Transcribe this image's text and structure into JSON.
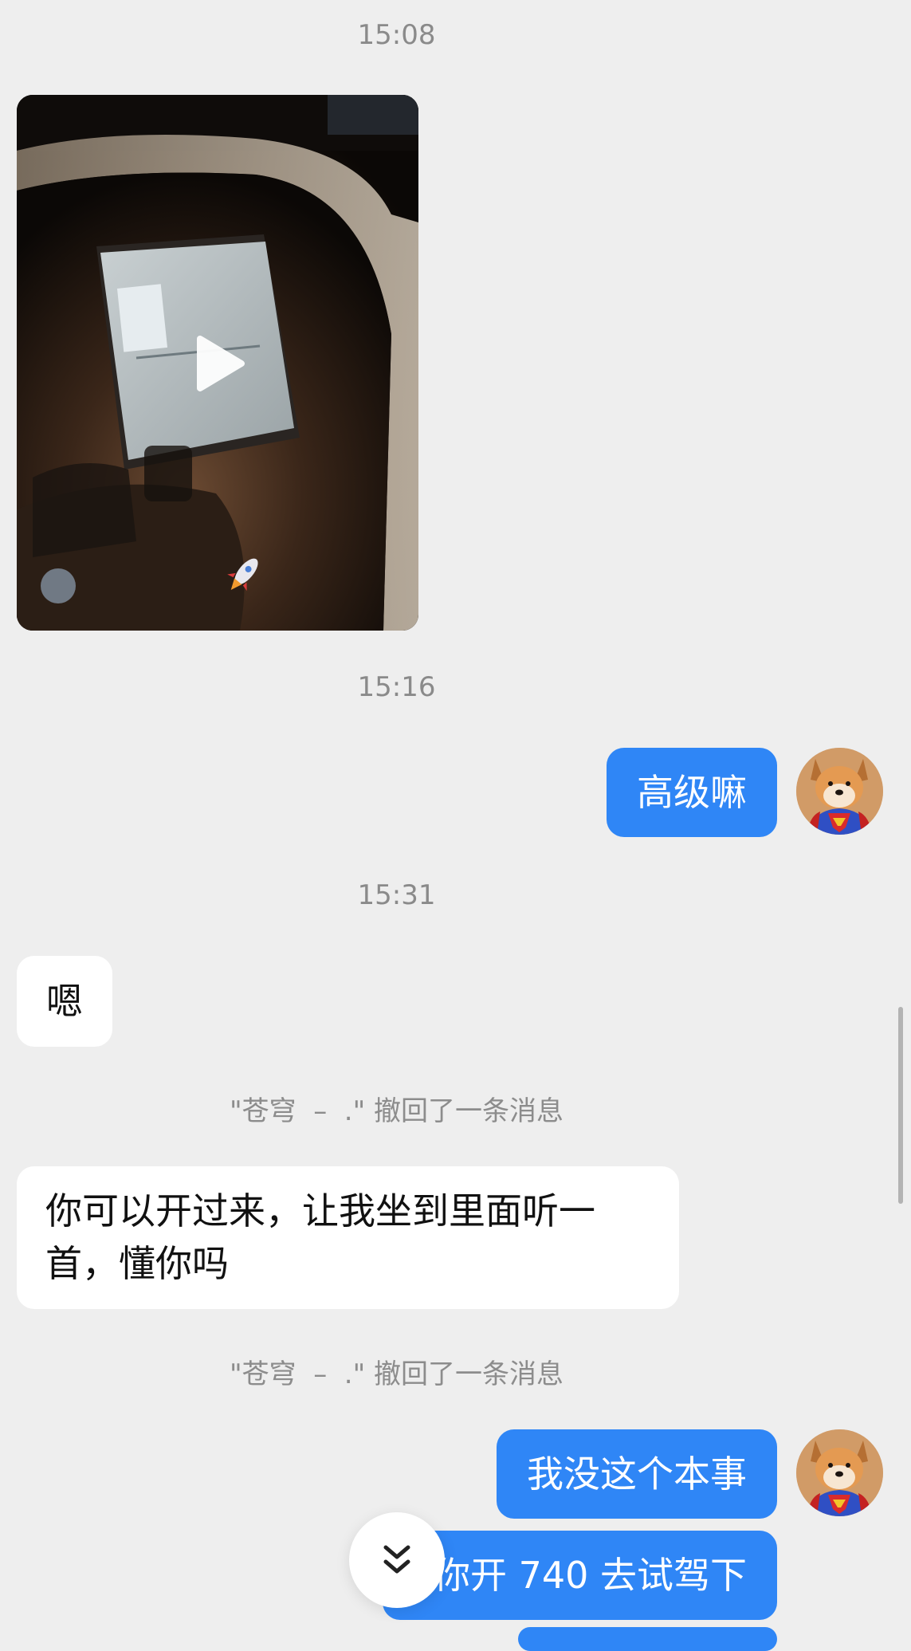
{
  "messages": [
    {
      "kind": "timestamp",
      "text": "15:08"
    },
    {
      "kind": "video",
      "sender": "other"
    },
    {
      "kind": "timestamp",
      "text": "15:16"
    },
    {
      "kind": "text",
      "sender": "me",
      "text": "高级嘛"
    },
    {
      "kind": "timestamp",
      "text": "15:31"
    },
    {
      "kind": "text",
      "sender": "other",
      "text": "嗯"
    },
    {
      "kind": "system",
      "text": "\"苍穹  –  .\" 撤回了一条消息"
    },
    {
      "kind": "text",
      "sender": "other",
      "lines": [
        "你可以开过来，让我坐到里面听一",
        "首，懂你吗"
      ]
    },
    {
      "kind": "system",
      "text": "\"苍穹  –  .\" 撤回了一条消息"
    },
    {
      "kind": "text",
      "sender": "me",
      "text": "我没这个本事"
    },
    {
      "kind": "text",
      "sender": "me",
      "text": "你开 740 去试驾下"
    }
  ],
  "icons": {
    "play": "play-icon",
    "scroll_down": "double-chevron-down-icon",
    "avatar": "shiba-superhero-avatar"
  },
  "colors": {
    "background": "#eeeeee",
    "outgoing_bubble": "#2f86f6",
    "incoming_bubble": "#ffffff",
    "timestamp_text": "#8a8a8a"
  }
}
